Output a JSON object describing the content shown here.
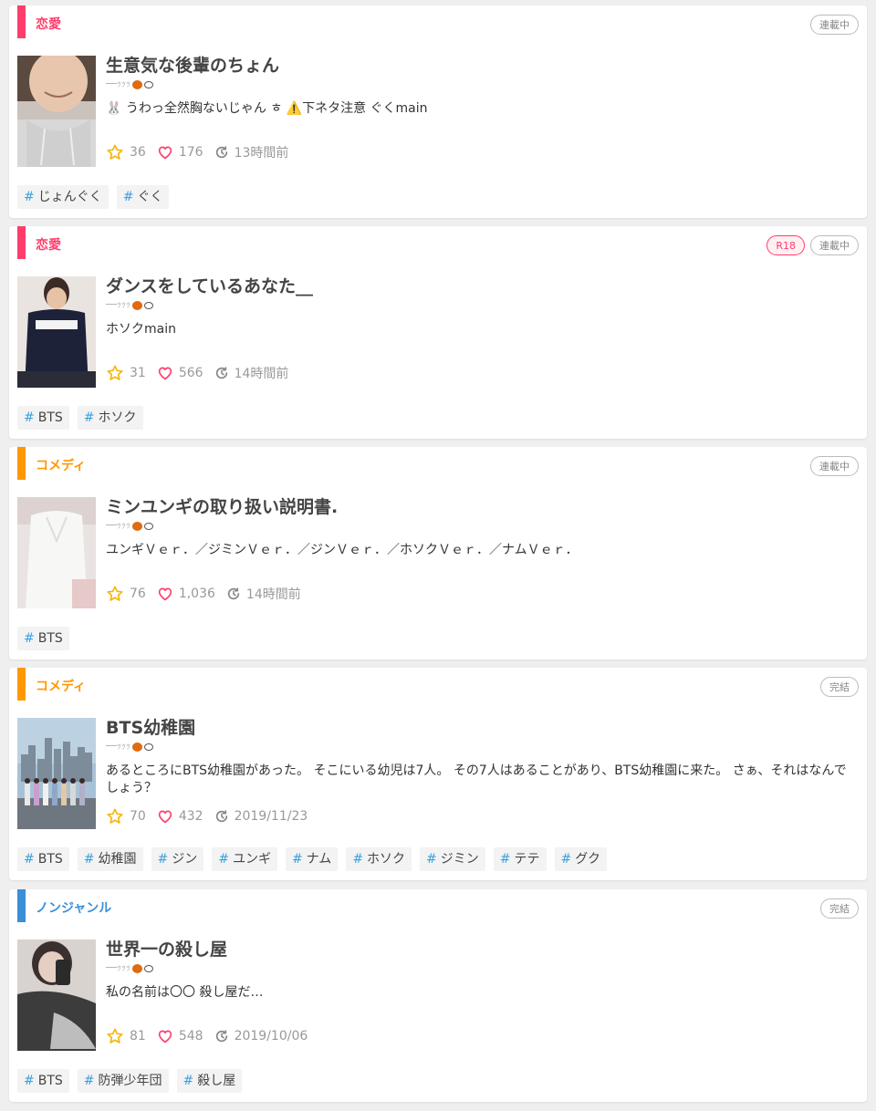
{
  "feed": {
    "items": [
      {
        "genre": "恋愛",
        "genre_color": "#ff3d6b",
        "badges": [
          "連載中"
        ],
        "title": "生意気な後輩のちょん",
        "author": "──ｯｯｯ",
        "description": "🐰 うわっ全然胸ないじゃん ㅎ ⚠️下ネタ注意 ぐくmain",
        "stars": "36",
        "likes": "176",
        "updated": "13時間前",
        "tags": [
          "じょんぐく",
          "ぐく"
        ]
      },
      {
        "genre": "恋愛",
        "genre_color": "#ff3d6b",
        "badges": [
          "R18",
          "連載中"
        ],
        "title": "ダンスをしているあなた__",
        "author": "──ｯｯｯ",
        "description": "ホソクmain",
        "stars": "31",
        "likes": "566",
        "updated": "14時間前",
        "tags": [
          "BTS",
          "ホソク"
        ]
      },
      {
        "genre": "コメディ",
        "genre_color": "#ff9800",
        "badges": [
          "連載中"
        ],
        "title": "ミンユンギの取り扱い説明書.",
        "author": "──ｯｯｯ",
        "description": "ユンギＶｅｒ．／ジミンＶｅｒ．／ジンＶｅｒ．／ホソクＶｅｒ．／ナムＶｅｒ．",
        "stars": "76",
        "likes": "1,036",
        "updated": "14時間前",
        "tags": [
          "BTS"
        ]
      },
      {
        "genre": "コメディ",
        "genre_color": "#ff9800",
        "badges": [
          "完結"
        ],
        "title": "BTS幼稚園",
        "author": "──ｯｯｯ",
        "description": "あるところにBTS幼稚園があった。 そこにいる幼児は7人。 その7人はあることがあり、BTS幼稚園に来た。 さぁ、それはなんでしょう？",
        "stars": "70",
        "likes": "432",
        "updated": "2019/11/23",
        "tags": [
          "BTS",
          "幼稚園",
          "ジン",
          "ユンギ",
          "ナム",
          "ホソク",
          "ジミン",
          "テテ",
          "グク"
        ]
      },
      {
        "genre": "ノンジャンル",
        "genre_color": "#3a8fd8",
        "badges": [
          "完結"
        ],
        "title": "世界一の殺し屋",
        "author": "──ｯｯｯ",
        "description": "私の名前は〇〇 殺し屋だ…",
        "stars": "81",
        "likes": "548",
        "updated": "2019/10/06",
        "tags": [
          "BTS",
          "防弾少年団",
          "殺し屋"
        ]
      }
    ]
  },
  "icons": {
    "star": "star-icon",
    "heart": "heart-icon",
    "clock": "clock-icon",
    "hash": "#"
  },
  "colors": {
    "star": "#f5b50a",
    "heart": "#ff3d6b",
    "hash": "#3aa0e0"
  }
}
